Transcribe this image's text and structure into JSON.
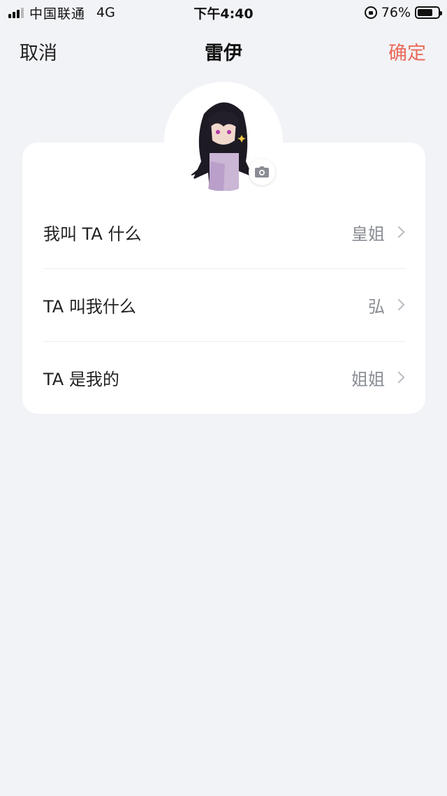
{
  "status_bar": {
    "carrier": "中国联通",
    "network": "4G",
    "time": "下午4:40",
    "battery_percent": "76%",
    "battery_level": 0.76
  },
  "nav": {
    "cancel": "取消",
    "title": "雷伊",
    "confirm": "确定",
    "confirm_color": "#e96a5a"
  },
  "avatar": {
    "icon": "camera-icon"
  },
  "rows": [
    {
      "label": "我叫 TA 什么",
      "value": "皇姐"
    },
    {
      "label": "TA 叫我什么",
      "value": "弘"
    },
    {
      "label": "TA 是我的",
      "value": "姐姐"
    }
  ]
}
